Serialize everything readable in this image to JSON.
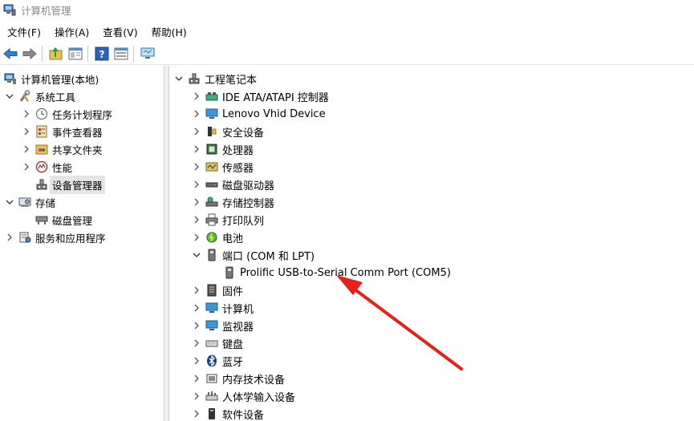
{
  "window": {
    "title": "计算机管理"
  },
  "menu": [
    "文件(F)",
    "操作(A)",
    "查看(V)",
    "帮助(H)"
  ],
  "left_tree": {
    "root": "计算机管理(本地)",
    "system_tools": "系统工具",
    "task_scheduler": "任务计划程序",
    "event_viewer": "事件查看器",
    "shared_folders": "共享文件夹",
    "performance": "性能",
    "device_manager": "设备管理器",
    "storage": "存储",
    "disk_management": "磁盘管理",
    "services_apps": "服务和应用程序"
  },
  "device_tree": {
    "root": "工程笔记本",
    "ide": "IDE ATA/ATAPI 控制器",
    "lenovo": "Lenovo Vhid Device",
    "security": "安全设备",
    "processor": "处理器",
    "sensor": "传感器",
    "disk_drive": "磁盘驱动器",
    "storage_ctrl": "存储控制器",
    "print_queue": "打印队列",
    "battery": "电池",
    "ports": "端口 (COM 和 LPT)",
    "prolific": "Prolific USB-to-Serial Comm Port (COM5)",
    "firmware": "固件",
    "computer": "计算机",
    "monitor": "监视器",
    "keyboard": "键盘",
    "bluetooth": "蓝牙",
    "memory_tech": "内存技术设备",
    "hid": "人体学输入设备",
    "software_dev": "软件设备"
  },
  "colors": {
    "arrow": "#e8201a",
    "selected_bg": "#e5e5e5"
  }
}
